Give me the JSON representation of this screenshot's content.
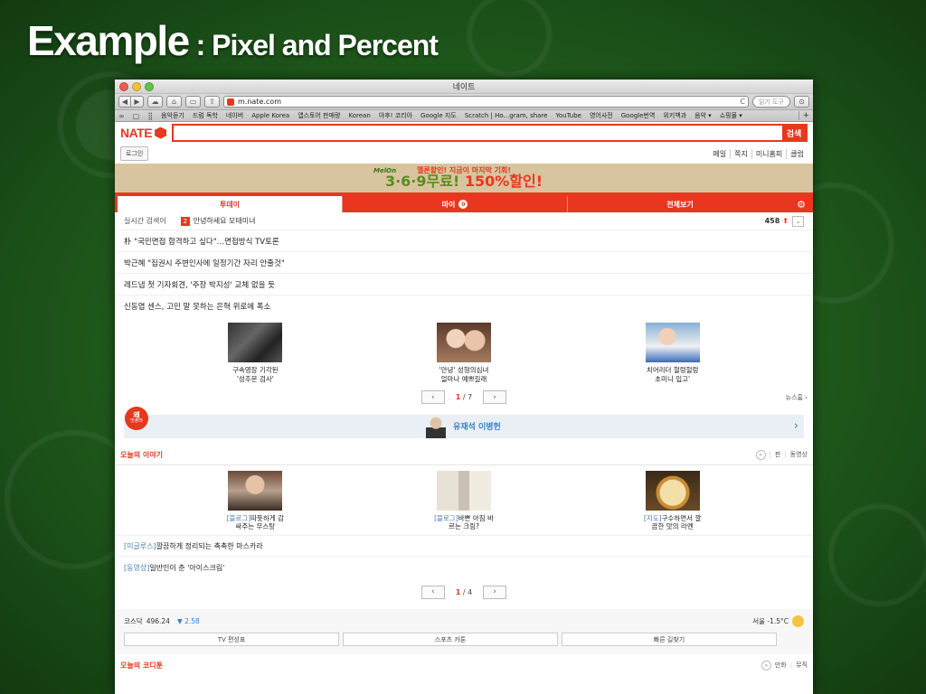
{
  "slide": {
    "title_big": "Example",
    "title_small": " : Pixel and Percent"
  },
  "window": {
    "title": "네이트"
  },
  "toolbar": {
    "back": "◀",
    "forward": "▶",
    "url": "m.nate.com",
    "reload": "C",
    "search_placeholder": "읽기 도구"
  },
  "bookmarks": [
    "음악듣기",
    "드럼 독학",
    "네이버",
    "Apple Korea",
    "앱스토어 판매량",
    "Korean",
    "야후! 코리아",
    "Google 지도",
    "Scratch | Ho...gram, share",
    "YouTube",
    "영어사전",
    "Google번역",
    "위키백과",
    "음악 ▾",
    "쇼핑몰 ▾"
  ],
  "nate": {
    "logo": "NATE",
    "search_button": "검색",
    "search_value": "",
    "login": "로그인",
    "quicklinks": [
      "메일",
      "쪽지",
      "미니홈피",
      "클럽"
    ]
  },
  "banner": {
    "brand": "MelOn",
    "top": "멜론할인! 지금이 마지막 기회!",
    "main_a": "3·6·9무료! ",
    "main_b": "150%할인!"
  },
  "tabs": {
    "today": "투데이",
    "my": "마이",
    "my_badge": "0",
    "all": "전체보기",
    "gear": "⚙"
  },
  "trend": {
    "label": "실시간 검색어",
    "rank": "2",
    "keyword": "안녕하세요 모태미녀",
    "count": "458",
    "up": "⬆",
    "more": "⌄"
  },
  "headlines": [
    "朴 \"국민면접 합격하고 싶다\"…면접방식 TV토론",
    "박근혜 \"집권시 주변인사에 일정기간 자리 안줄것\"",
    "레드냅 첫 기자회견, '주장 박지성' 교체 없을 듯",
    "신동엽 센스, 고민 말 못하는 은혁 위로에 폭소"
  ],
  "news_thumbs": [
    {
      "line1": "구속영장 기각된",
      "line2": "'성추문 검사'"
    },
    {
      "line1": "'안녕' 성형의심녀",
      "line2": "얼마나 예쁘길래"
    },
    {
      "line1": "치어리더 헐렁헐렁",
      "line2": "초미니 입고'"
    }
  ],
  "pager1": {
    "prev": "‹",
    "next": "›",
    "current": "1",
    "sep": " / ",
    "total": "7",
    "news_home": "뉴스홈 ›"
  },
  "promo": {
    "badge_top": "왜",
    "badge_bottom": "맛플러",
    "text": "유재석 이병헌",
    "arrow": "›"
  },
  "story": {
    "title": "오늘의 이야기",
    "prev": "«",
    "tools": [
      "판",
      "동영상"
    ],
    "sep": "|",
    "thumbs": [
      {
        "tag": "[블로그]",
        "line1": "따뜻하게 감",
        "line2": "싸주는 무스탕"
      },
      {
        "tag": "[블로그]",
        "line1": "바쁜 아침 바",
        "line2": "르는 크림?"
      },
      {
        "tag": "[지도]",
        "line1": "구수하면서 깔",
        "line2": "끔한 맛의 라멘"
      }
    ],
    "lines": [
      {
        "tag": "[미글루스]",
        "text": "깔끔하게 정리되는 촉촉한 마스카라"
      },
      {
        "tag": "[동영상]",
        "text": "일반인이 춘 '아이스크림'"
      }
    ]
  },
  "pager2": {
    "prev": "‹",
    "next": "›",
    "current": "1",
    "sep": " / ",
    "total": "4"
  },
  "stock": {
    "label": "코스닥",
    "value": "496.24",
    "arrow": "▼",
    "change": "2.58"
  },
  "weather": {
    "text": "서울 -1.5°C"
  },
  "utils": [
    "TV 편성표",
    "스포츠 카툰",
    "빠른 길찾기"
  ],
  "bottom": {
    "title": "오늘의 코디툰",
    "prev": "«",
    "tools": [
      "만화",
      "뮤직"
    ]
  },
  "colors": {
    "brand": "#e8371e",
    "link": "#3a7fc4",
    "tag": "#4a7fb5"
  }
}
